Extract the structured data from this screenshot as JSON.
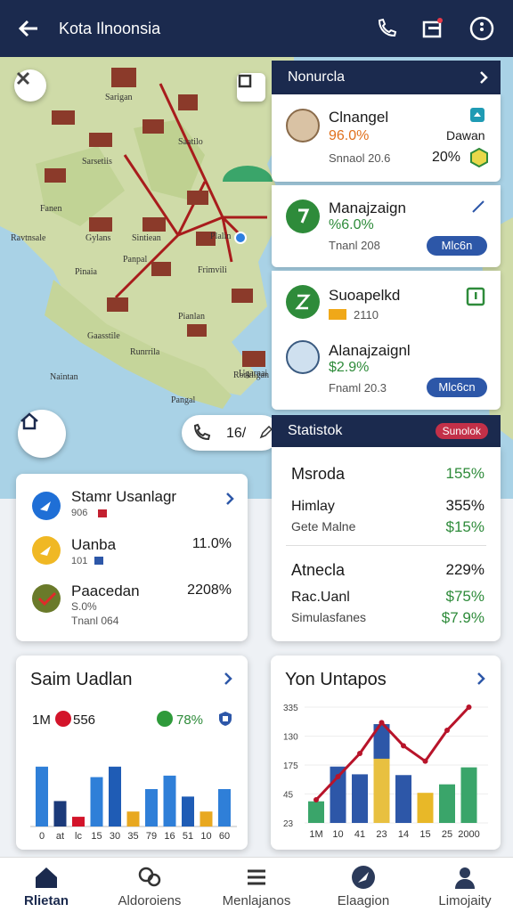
{
  "header": {
    "title": "Kota Ilnoonsia"
  },
  "map": {
    "labels": [
      "Sarigan",
      "Saatilo",
      "Sarsetiis",
      "Fanen",
      "Ravtnsale",
      "Gylans",
      "Sintiean",
      "Plalin",
      "Panpal",
      "Frimvili",
      "Pinaia",
      "Pianlan",
      "Gaasstile",
      "Runrrila",
      "Naintan",
      "Rorkligan",
      "Pangal",
      "Ugarnai"
    ],
    "zoom_value": "16/"
  },
  "right_panel": {
    "header": "Nonurcla",
    "cards": [
      {
        "name": "Clnangel",
        "pct": "96.0%",
        "sub": "Snnaol 20.6",
        "right_label": "Dawan",
        "right_pct": "20%"
      },
      {
        "name": "Manajzaign",
        "pct": "%6.0%",
        "sub": "Tnanl 208",
        "pill": "Mlc6n"
      },
      {
        "name": "Suoapelkd",
        "sub": "2110"
      },
      {
        "name": "Alanajzaignl",
        "pct": "$2.9%",
        "sub": "Fnaml 20.3",
        "pill": "Mlc6cn"
      }
    ]
  },
  "statistics": {
    "title": "Statistok",
    "badge": "Sunolok",
    "rows": [
      {
        "label": "Msroda",
        "value": "155%"
      },
      {
        "label": "Himlay",
        "value": "355%"
      },
      {
        "label": "Gete Malne",
        "value": "$15%"
      },
      {
        "label": "Atnecla",
        "value": "229%"
      },
      {
        "label": "Rac.Uanl",
        "value": "$75%"
      },
      {
        "label": "Simulasfanes",
        "value": "$7.9%"
      }
    ]
  },
  "left_list": {
    "items": [
      {
        "name": "Stamr Usanlagr",
        "sub": "906",
        "value": ""
      },
      {
        "name": "Uanba",
        "sub": "101",
        "value": "11.0%"
      },
      {
        "name": "Paacedan",
        "sub": "S.0%",
        "sub2": "Tnanl 064",
        "value": "2208%"
      }
    ]
  },
  "chart_left": {
    "title": "Saim Uadlan",
    "legend_a": "1M",
    "legend_a_val": "556",
    "legend_b_val": "78%",
    "x_labels": [
      "0",
      "at",
      "lc",
      "15",
      "30",
      "35",
      "79",
      "16",
      "51",
      "10",
      "60"
    ]
  },
  "chart_right": {
    "title": "Yon Untapos",
    "y_labels": [
      "335",
      "130",
      "175",
      "45",
      "23"
    ],
    "x_labels": [
      "1M",
      "10",
      "41",
      "23",
      "14",
      "15",
      "25",
      "2000"
    ]
  },
  "chart_data": [
    {
      "type": "bar",
      "title": "Saim Uadlan",
      "categories": [
        "0",
        "at",
        "lc",
        "15",
        "30",
        "35",
        "79",
        "16",
        "51",
        "10",
        "60"
      ],
      "series": [
        {
          "values": [
            80,
            34,
            13,
            66,
            80,
            20,
            50,
            68,
            40,
            20,
            50
          ]
        }
      ],
      "ylim": [
        0,
        100
      ]
    },
    {
      "type": "bar",
      "title": "Yon Untapos",
      "categories": [
        "1M",
        "10",
        "41",
        "23",
        "14",
        "15",
        "25",
        "2000"
      ],
      "series": [
        {
          "values": [
            28,
            73,
            63,
            128,
            62,
            39,
            50,
            72
          ]
        },
        {
          "values": [
            30,
            60,
            90,
            130,
            100,
            80,
            120,
            150
          ]
        }
      ],
      "ylim": [
        0,
        150
      ]
    }
  ],
  "bottom_nav": [
    {
      "label": "Rlietan",
      "active": true
    },
    {
      "label": "Aldoroiens"
    },
    {
      "label": "Menlajanos"
    },
    {
      "label": "Elaagion"
    },
    {
      "label": "Limojaity"
    }
  ],
  "colors": {
    "navy": "#1b2a4e",
    "accent": "#2d57a8",
    "green": "#2e8b3a",
    "orange": "#e0701c",
    "red": "#c33048"
  }
}
